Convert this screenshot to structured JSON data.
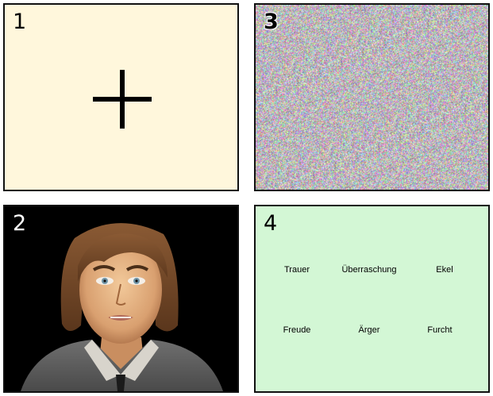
{
  "panels": [
    {
      "number": "1",
      "content": "fixation cross"
    },
    {
      "number": "2",
      "content": "avatar face"
    },
    {
      "number": "3",
      "content": "colour noise"
    },
    {
      "number": "4",
      "content": "emotion labels"
    }
  ],
  "emotions": [
    "Trauer",
    "Überraschung",
    "Ekel",
    "Freude",
    "Ärger",
    "Furcht"
  ],
  "colors": {
    "panel1_bg": "#fff7dc",
    "panel4_bg": "#d3f7d5",
    "panel2_bg": "#000000"
  }
}
